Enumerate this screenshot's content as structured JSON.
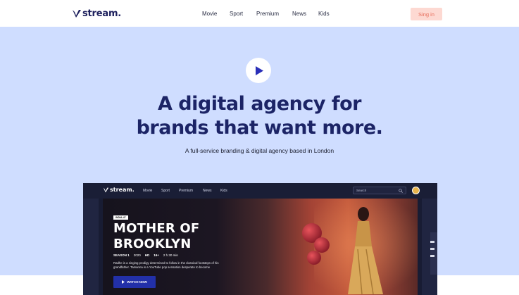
{
  "header": {
    "brand": "stream.",
    "nav": [
      "Movie",
      "Sport",
      "Premium",
      "News",
      "Kids"
    ],
    "signin_label": "Sing in"
  },
  "hero": {
    "headline_line1": "A digital agency for",
    "headline_line2": "brands that want more.",
    "subline": "A full-service branding & digital agency based in London",
    "play_icon": "play-icon"
  },
  "app": {
    "brand": "stream.",
    "nav": [
      "Movie",
      "Sport",
      "Premium",
      "News",
      "Kids"
    ],
    "search_placeholder": "Search",
    "featured": {
      "badge": "INDIA-47",
      "title_line1": "MOTHER OF",
      "title_line2": "BROOKLYN",
      "season": "SEASON 1",
      "year": "2020",
      "quality": "HD",
      "rating": "16+",
      "duration": "2 h 30 min",
      "description": "Radhe is a singing prodigy determined to follow in the classical footsteps of his grandfather. Tamanna is a YouTube pop sensation desperate to become",
      "cta": "WATCH NOW"
    }
  },
  "colors": {
    "hero_bg": "#cfddff",
    "brand_navy": "#1c2466",
    "signin_bg": "#fdd9d2",
    "signin_text": "#e76e5c",
    "cta_blue": "#2230a8"
  }
}
